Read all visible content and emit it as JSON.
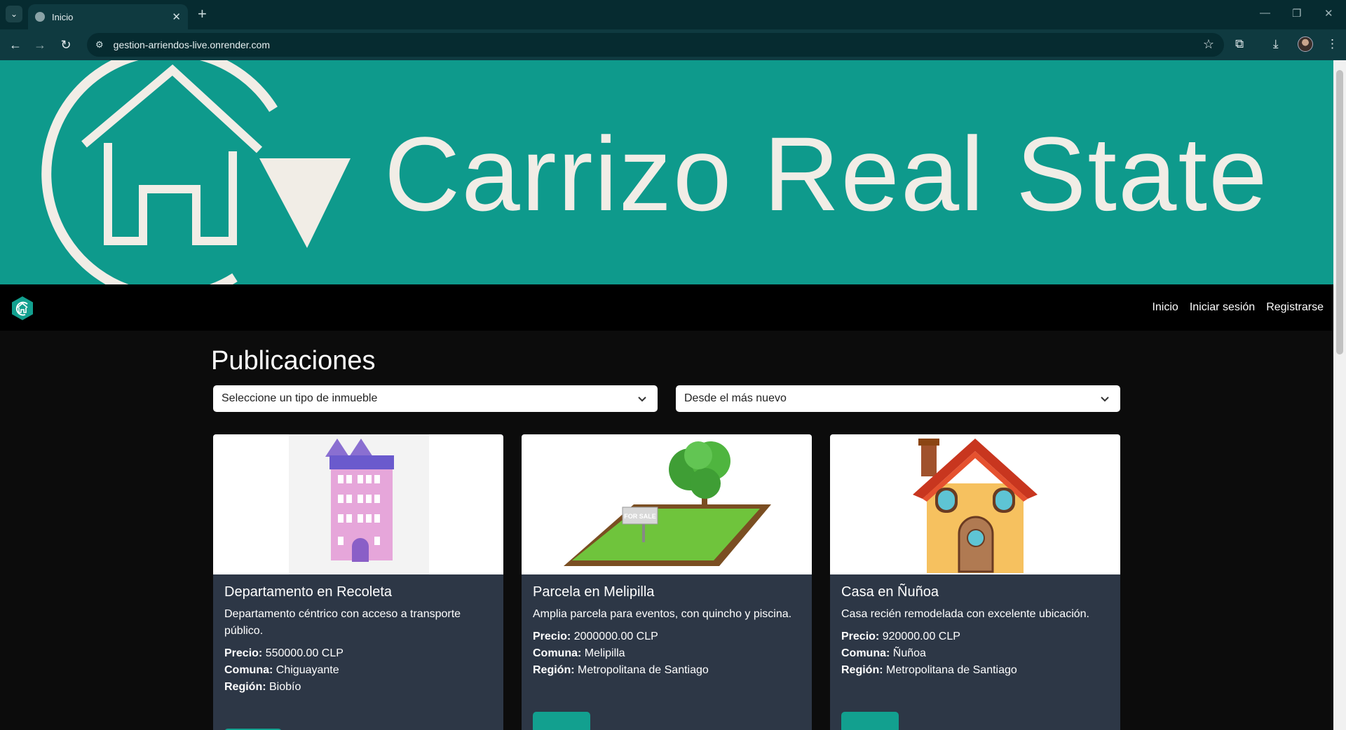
{
  "browser": {
    "tab_title": "Inicio",
    "url": "gestion-arriendos-live.onrender.com"
  },
  "banner": {
    "title": "Carrizo Real State"
  },
  "navbar": {
    "links": [
      "Inicio",
      "Iniciar sesión",
      "Registrarse"
    ]
  },
  "main": {
    "title": "Publicaciones",
    "filter_type": "Seleccione un tipo de inmueble",
    "filter_order": "Desde el más nuevo"
  },
  "cards": [
    {
      "title": "Departamento en Recoleta",
      "description": "Departamento céntrico con acceso a transporte público.",
      "price_label": "Precio:",
      "price": "550000.00 CLP",
      "comuna_label": "Comuna:",
      "comuna": "Chiguayante",
      "region_label": "Región:",
      "region": "Biobío"
    },
    {
      "title": "Parcela en Melipilla",
      "description": "Amplia parcela para eventos, con quincho y piscina.",
      "price_label": "Precio:",
      "price": "2000000.00 CLP",
      "comuna_label": "Comuna:",
      "comuna": "Melipilla",
      "region_label": "Región:",
      "region": "Metropolitana de Santiago"
    },
    {
      "title": "Casa en Ñuñoa",
      "description": "Casa recién remodelada con excelente ubicación.",
      "price_label": "Precio:",
      "price": "920000.00 CLP",
      "comuna_label": "Comuna:",
      "comuna": "Ñuñoa",
      "region_label": "Región:",
      "region": "Metropolitana de Santiago"
    }
  ],
  "colors": {
    "brand_teal": "#0e9a8c",
    "card_bg": "#2d3746",
    "chrome_dark": "#062b30"
  }
}
